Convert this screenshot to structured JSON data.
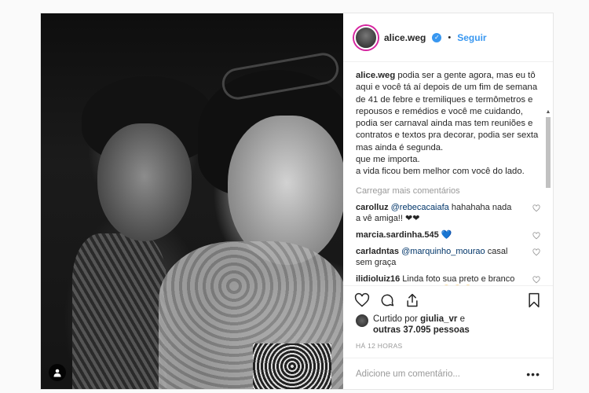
{
  "header": {
    "username": "alice.weg",
    "separator": "•",
    "follow_label": "Seguir"
  },
  "caption": {
    "username": "alice.weg",
    "text": "podia ser a gente agora, mas eu tô aqui e você tá aí depois de um fim de semana de 41 de febre e tremiliques e termômetros e repousos e remédios e você me cuidando, podia ser carnaval ainda mas tem reuniões e contratos e textos pra decorar, podia ser sexta mas ainda é segunda.\nque me importa.\na vida ficou bem melhor com você do lado."
  },
  "load_more_label": "Carregar mais comentários",
  "comments": [
    {
      "user": "carolluz",
      "mention": "@rebecacaiafa",
      "text": " hahahaha nada a vê amiga!! ❤❤"
    },
    {
      "user": "marcia.sardinha.545",
      "mention": "",
      "text": " 💙"
    },
    {
      "user": "carladntas",
      "mention": "@marquinho_mourao",
      "text": " casal sem graça"
    },
    {
      "user": "ilidioluiz16",
      "mention": "",
      "text": " Linda foto sua preto e branco com amigo alice_weg 😊😊😊"
    }
  ],
  "likes": {
    "prefix": "Curtido por",
    "user": "giulia_vr",
    "conj": "e",
    "others": "outras 37.095 pessoas"
  },
  "timestamp": "HÁ 12 HORAS",
  "add_comment_placeholder": "Adicione um comentário...",
  "more_options": "•••",
  "icons": [
    "heart-icon",
    "comment-icon",
    "share-icon",
    "bookmark-icon",
    "user-tag-icon",
    "verified-badge-icon"
  ],
  "colors": {
    "link": "#3897f0",
    "text": "#262626",
    "muted": "#999999"
  }
}
